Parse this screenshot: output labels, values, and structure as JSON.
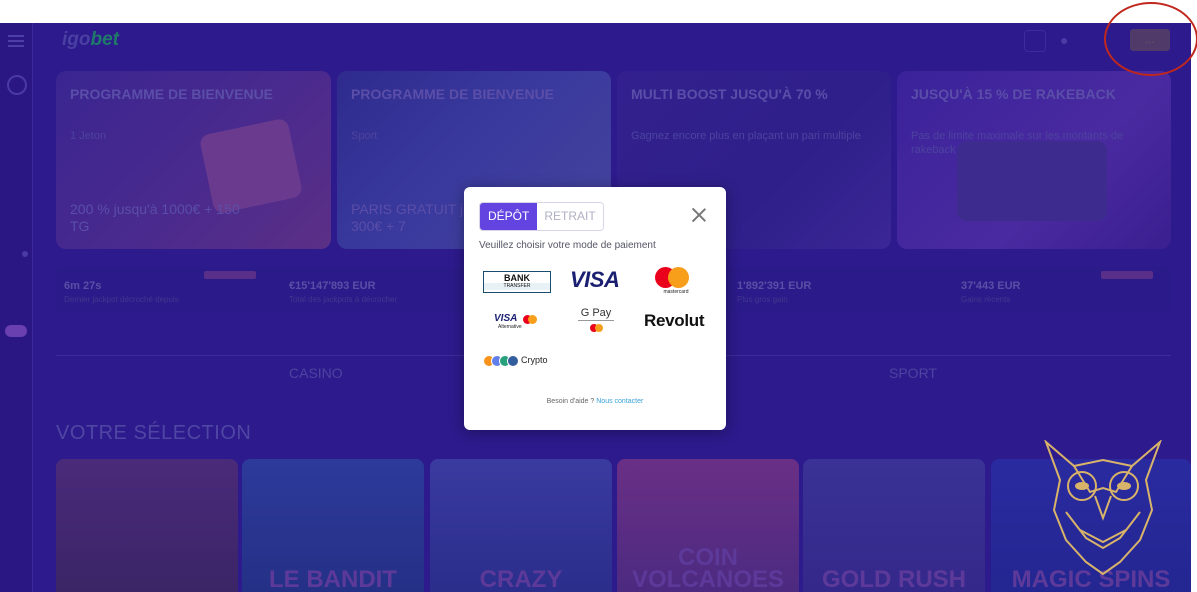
{
  "header": {
    "logo_main": "igo",
    "logo_accent": "bet",
    "account_button": "..."
  },
  "banners": [
    {
      "title": "PROGRAMME DE BIENVENUE",
      "subtitle": "1 Jeton",
      "big": "200 % jusqu'à 1000€ + 150 TG"
    },
    {
      "title": "PROGRAMME DE BIENVENUE",
      "subtitle": "Sport",
      "big": "PARIS GRATUIT jusqu'à 300€ + 7"
    },
    {
      "title": "MULTI BOOST JUSQU'À 70 %",
      "subtitle": "Gagnez encore plus en plaçant un pari multiple",
      "big": ""
    },
    {
      "title": "JUSQU'À 15 % DE RAKEBACK",
      "subtitle": "Pas de limite maximale sur les montants de rakeback",
      "big": ""
    }
  ],
  "stats": [
    {
      "value": "6m 27s",
      "label": "Dernier jackpot décroché depuis"
    },
    {
      "value": "€15'147'893 EUR",
      "label": "Total des jackpots à décrocher"
    },
    {
      "value": "1'892'391 EUR",
      "label": "Plus gros gain"
    },
    {
      "value": "37'443 EUR",
      "label": "Gains récents"
    }
  ],
  "tabs": {
    "casino": "CASINO",
    "sport": "SPORT"
  },
  "section": {
    "title": "VOTRE SÉLECTION"
  },
  "games": [
    {
      "name": ""
    },
    {
      "name": "LE BANDIT"
    },
    {
      "name": "CRAZY"
    },
    {
      "name": "COIN VOLCANOES"
    },
    {
      "name": "GOLD RUSH"
    },
    {
      "name": "MAGIC SPINS"
    }
  ],
  "modal": {
    "tab_deposit": "DÉPÔT",
    "tab_withdraw": "RETRAIT",
    "prompt": "Veuillez choisir votre mode de paiement",
    "methods": {
      "bank_line1": "BANK",
      "bank_line2": "TRANSFER",
      "visa": "VISA",
      "mastercard": "mastercard",
      "visa_alt": "VISA",
      "visa_alt_sub": "Alternative",
      "gpay": "G Pay",
      "revolut": "Revolut",
      "crypto": "Crypto"
    },
    "help_text": "Besoin d'aide ?",
    "help_link": "Nous contacter"
  },
  "colors": {
    "overlay_bg": "#2d1a8c",
    "primary_button": "#6344e0",
    "annotation": "#c0281e",
    "owl_gold": "#d8b36a"
  }
}
